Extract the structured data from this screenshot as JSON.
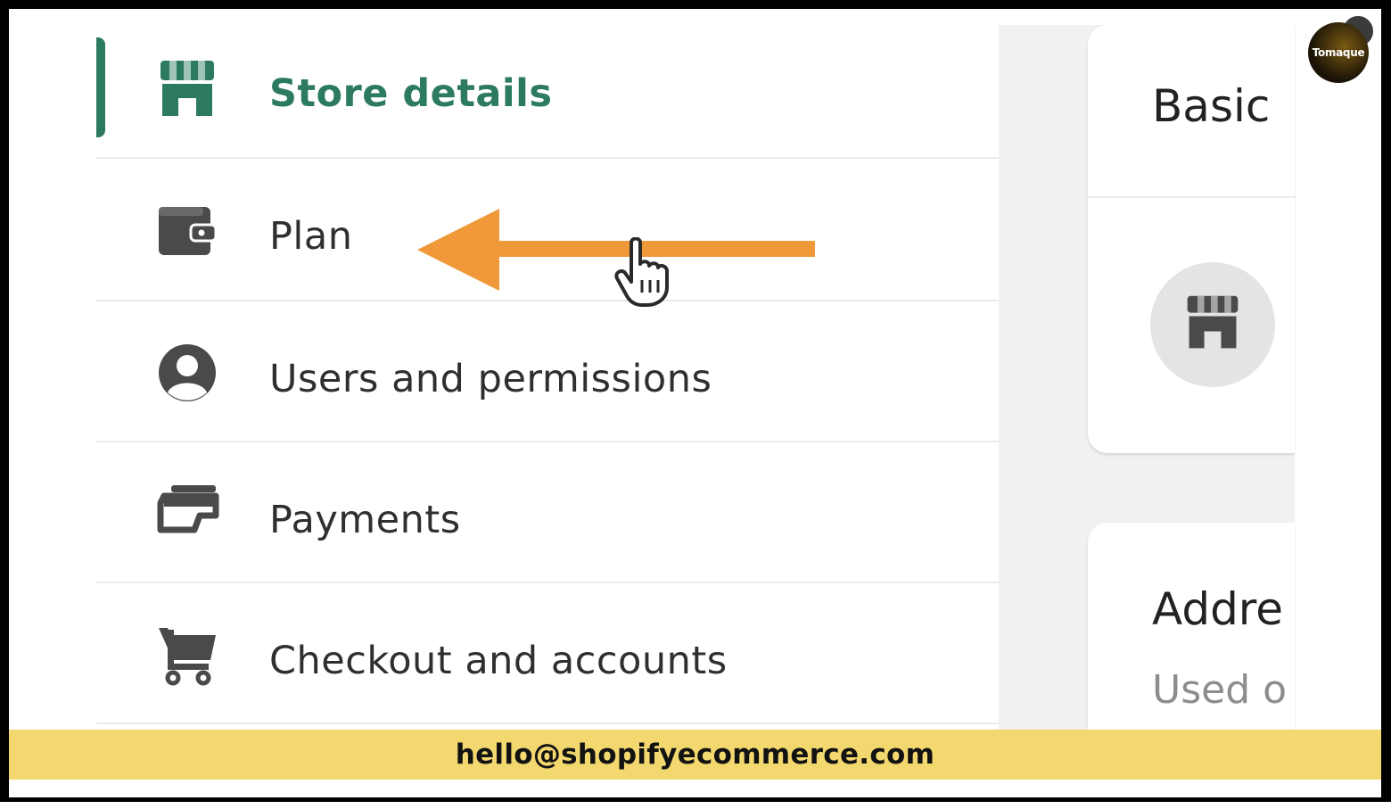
{
  "nav": {
    "items": [
      {
        "label": "Store details",
        "icon": "storefront-icon",
        "active": true
      },
      {
        "label": "Plan",
        "icon": "wallet-icon",
        "active": false
      },
      {
        "label": "Users and permissions",
        "icon": "user-circle-icon",
        "active": false
      },
      {
        "label": "Payments",
        "icon": "payments-icon",
        "active": false
      },
      {
        "label": "Checkout and accounts",
        "icon": "cart-icon",
        "active": false
      }
    ]
  },
  "main": {
    "basic_card": {
      "title": "Basic"
    },
    "address_card": {
      "title": "Addre",
      "subtitle": "Used o"
    }
  },
  "logo": {
    "text": "Tomaque"
  },
  "banner": {
    "email": "hello@shopifyecommerce.com"
  },
  "colors": {
    "accent_green": "#2c7a5f",
    "arrow_orange": "#f0993a",
    "banner_yellow": "#f2d86e",
    "icon_gray": "#4a4a4a"
  }
}
